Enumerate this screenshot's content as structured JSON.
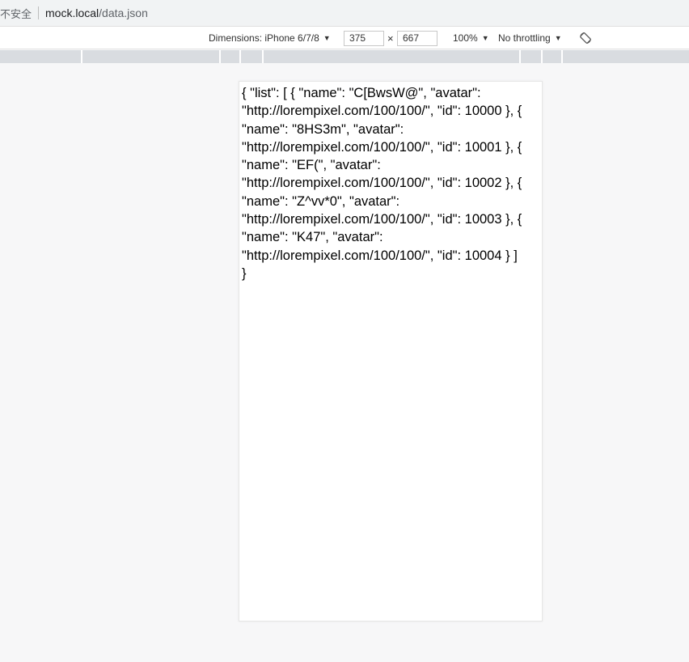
{
  "address_bar": {
    "security_label": "不安全",
    "url_host": "mock.local",
    "url_path": "/data.json"
  },
  "device_toolbar": {
    "dimensions_label": "Dimensions: iPhone 6/7/8",
    "width_value": "375",
    "times_symbol": "×",
    "height_value": "667",
    "zoom_label": "100%",
    "throttling_label": "No throttling",
    "rotate_icon": "rotate-icon"
  },
  "page_content": {
    "json_lines": [
      "{ \"list\": [ { \"name\": \"C[BwsW@\", \"avatar\":",
      "\"http://lorempixel.com/100/100/\", \"id\": 10000 }, {",
      "\"name\": \"8HS3m\", \"avatar\":",
      "\"http://lorempixel.com/100/100/\", \"id\": 10001 }, {",
      "\"name\": \"EF(\", \"avatar\":",
      "\"http://lorempixel.com/100/100/\", \"id\": 10002 }, {",
      "\"name\": \"Z^vv*0\", \"avatar\":",
      "\"http://lorempixel.com/100/100/\", \"id\": 10003 }, {",
      "\"name\": \"K47\", \"avatar\":",
      "\"http://lorempixel.com/100/100/\", \"id\": 10004 } ]",
      "}"
    ]
  }
}
